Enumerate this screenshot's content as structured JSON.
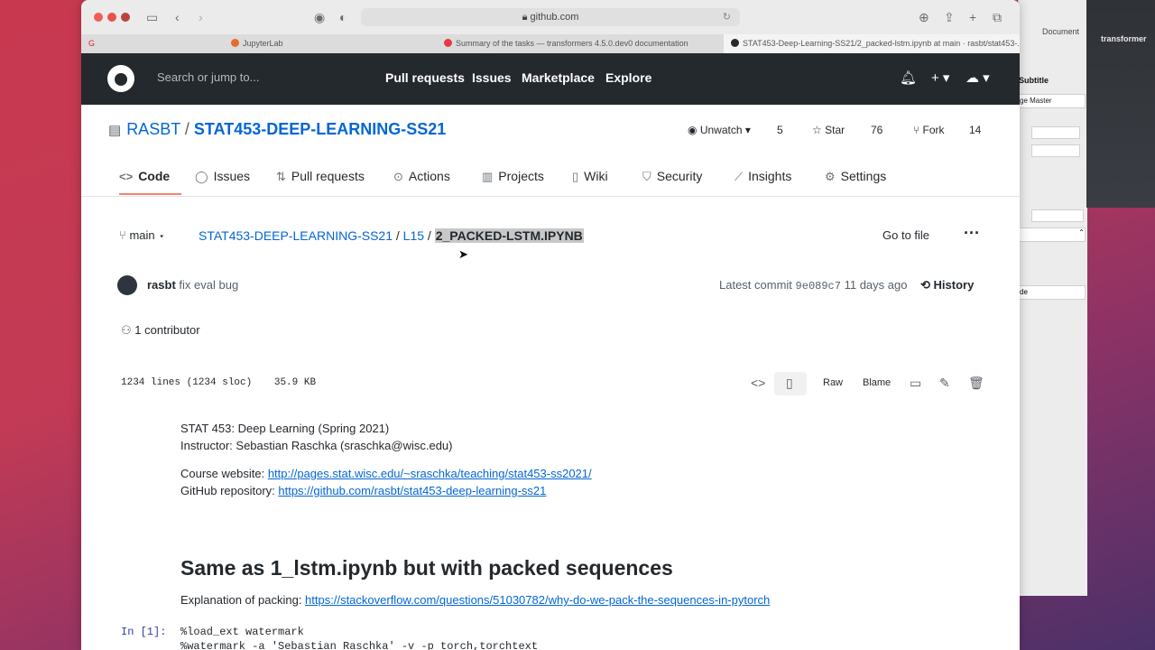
{
  "browser": {
    "url": "github.com",
    "tabs": [
      {
        "label": "JupyterLab",
        "color": "#e46e2e"
      },
      {
        "label": "Summary of the tasks — transformers 4.5.0.dev0 documentation",
        "color": "#e63946"
      },
      {
        "label": "STAT453-Deep-Learning-SS21/2_packed-lstm.ipynb at main · rasbt/stat453-...",
        "color": "#24292e"
      }
    ]
  },
  "github": {
    "search_placeholder": "Search or jump to...",
    "nav": [
      "Pull requests",
      "Issues",
      "Marketplace",
      "Explore"
    ]
  },
  "repo": {
    "owner": "RASBT",
    "separator": "/",
    "name": "STAT453-DEEP-LEARNING-SS21",
    "unwatch_label": "Unwatch",
    "watch_count": "5",
    "star_label": "Star",
    "star_count": "76",
    "fork_label": "Fork",
    "fork_count": "14",
    "tabs": [
      "Code",
      "Issues",
      "Pull requests",
      "Actions",
      "Projects",
      "Wiki",
      "Security",
      "Insights",
      "Settings"
    ]
  },
  "file_nav": {
    "branch": "main",
    "crumb_repo": "STAT453-DEEP-LEARNING-SS21",
    "crumb_dir": "L15",
    "crumb_file": "2_PACKED-LSTM.IPYNB",
    "goto_file": "Go to file",
    "more": "···"
  },
  "commit": {
    "author": "rasbt",
    "message": "fix eval bug",
    "latest_label": "Latest commit",
    "sha": "9e089c7",
    "when": "11 days ago",
    "history": "History"
  },
  "contributors": "1 contributor",
  "file_header": {
    "lines": "1234 lines (1234 sloc)",
    "size": "35.9 KB",
    "raw": "Raw",
    "blame": "Blame"
  },
  "notebook": {
    "line1": "STAT 453: Deep Learning (Spring 2021)",
    "line2": "Instructor: Sebastian Raschka (sraschka@wisc.edu)",
    "course_label": "Course website: ",
    "course_url": "http://pages.stat.wisc.edu/~sraschka/teaching/stat453-ss2021/",
    "repo_label": "GitHub repository: ",
    "repo_url": "https://github.com/rasbt/stat453-deep-learning-ss21",
    "heading": "Same as 1_lstm.ipynb but with packed sequences",
    "packing_label": "Explanation of packing: ",
    "packing_url": "https://stackoverflow.com/questions/51030782/why-do-we-pack-the-sequences-in-pytorch",
    "prompt": "In [1]:",
    "code1": "%load_ext watermark",
    "code2": "%watermark -a 'Sebastian Raschka' -v -p torch,torchtext"
  },
  "background_apps": {
    "doc_label": "Document",
    "subtitle": "Subtitle",
    "master": "ge Master",
    "de": "de",
    "dark_title": "transformer"
  }
}
